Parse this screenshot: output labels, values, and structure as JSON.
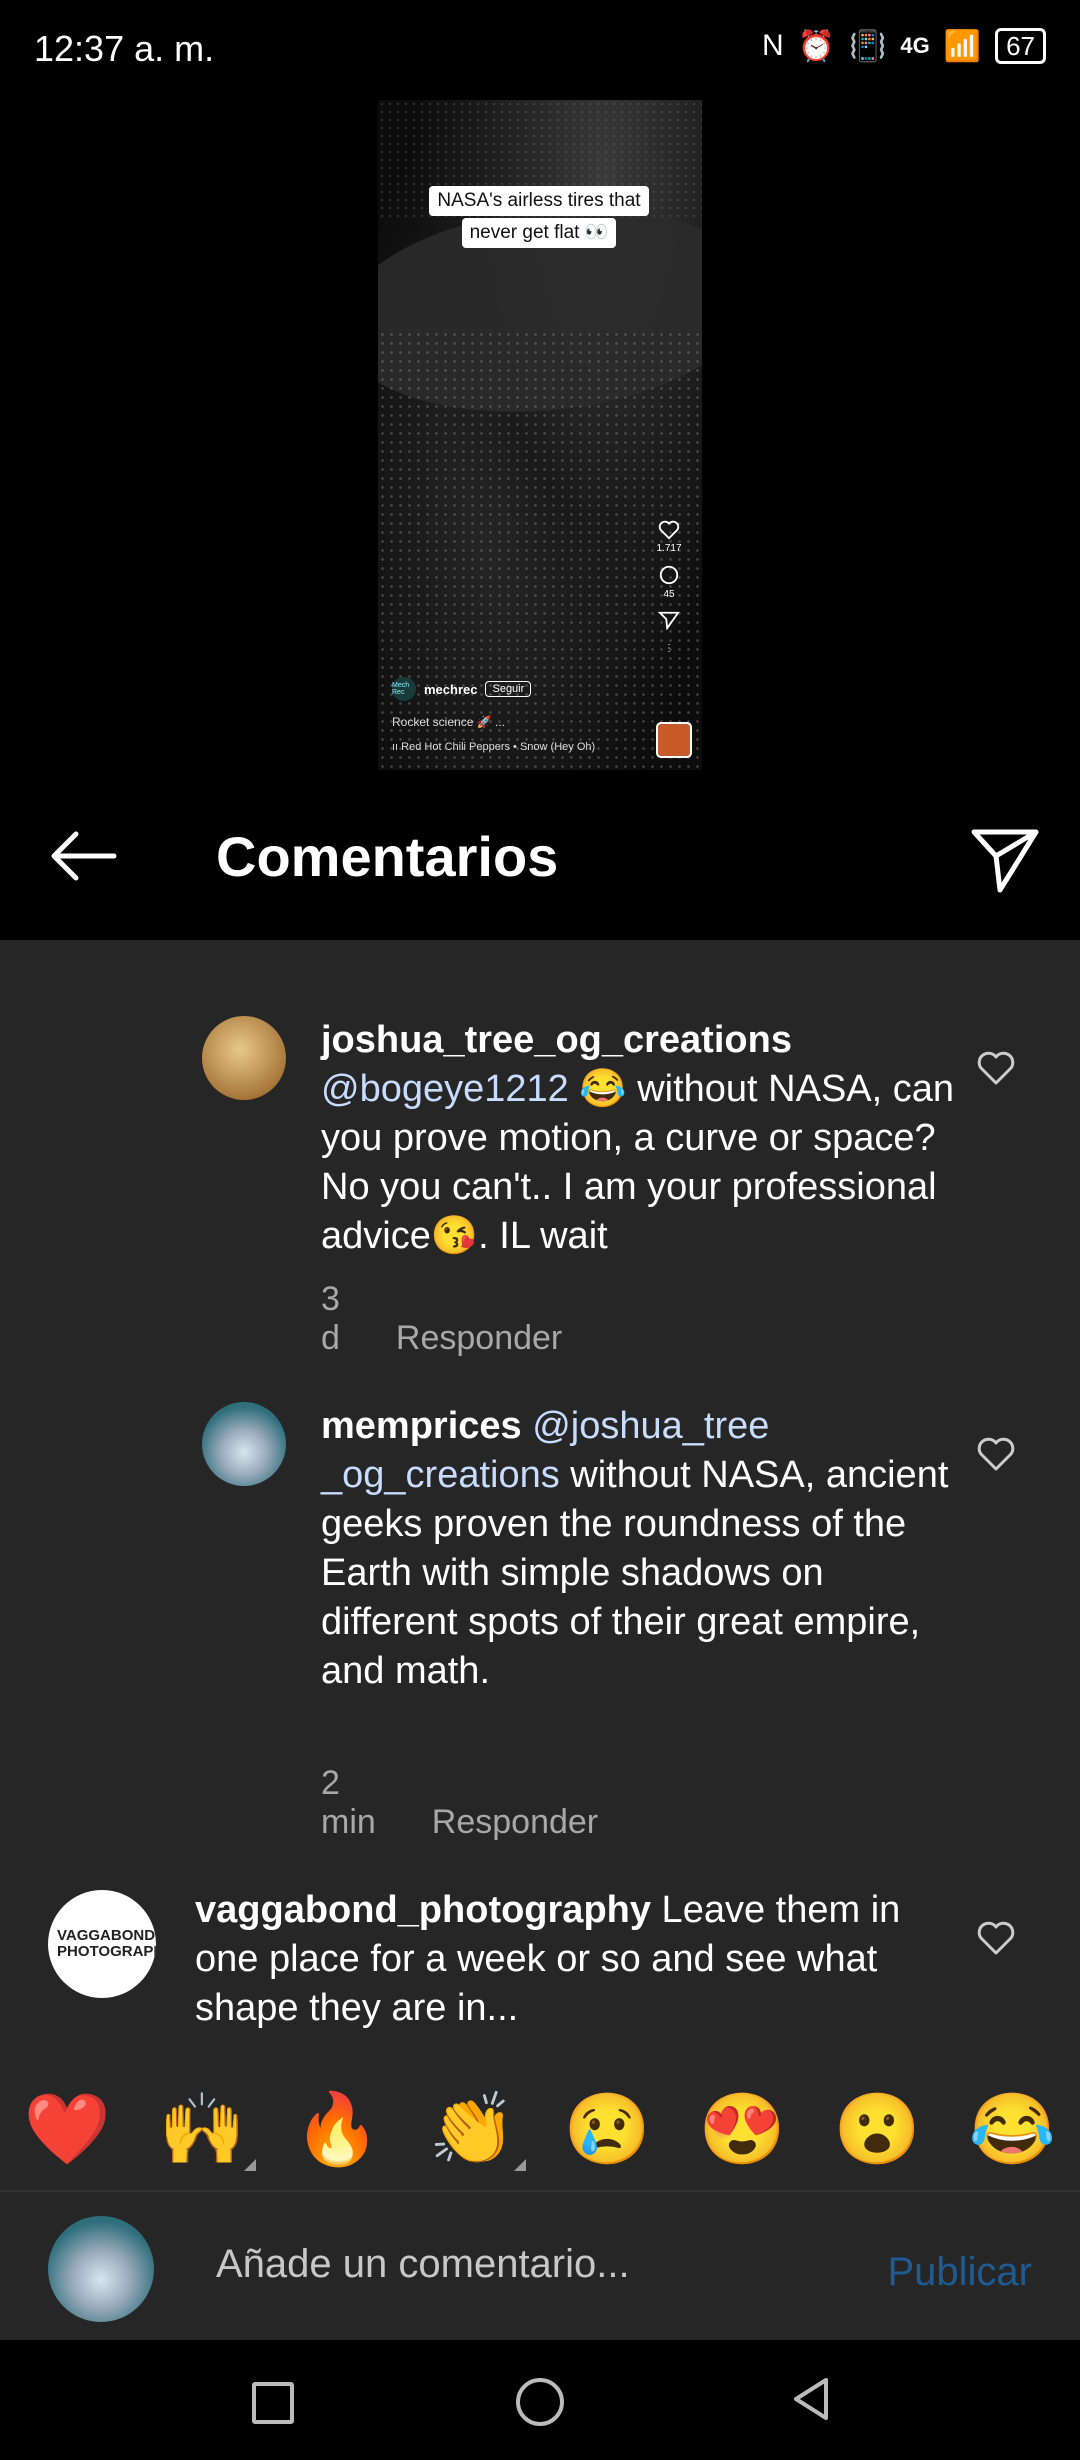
{
  "status_bar": {
    "time": "12:37 a. m.",
    "network": "4G",
    "battery": "67"
  },
  "reel": {
    "caption_line1": "NASA's airless tires that",
    "caption_line2": "never get flat 👀",
    "likes": "1.717",
    "comments": "45",
    "avatar_text": "Mech Rec",
    "username": "mechrec",
    "follow_label": "Seguir",
    "description": "Rocket science 🚀 ...",
    "music": "Red Hot Chili Peppers • Snow (Hey Oh)"
  },
  "header": {
    "title": "Comentarios"
  },
  "comments": [
    {
      "username": "joshua_tree_og_creations",
      "mention": "@bogeye1212",
      "text": " 😂 without NASA, can you prove motion, a curve or space?  No you can't.. I am your professional advice😘. IL wait",
      "time": "3 d",
      "reply_label": "Responder"
    },
    {
      "username": "memprices",
      "mention": " @joshua_tree _og_creations",
      "text": " without NASA, ancient geeks proven the roundness of the Earth with simple shadows on different spots of their great empire, and math.",
      "time": "2 min",
      "reply_label": "Responder"
    },
    {
      "username": "vaggabond_photography",
      "avatar_text": "VAGGABOND PHOTOGRAPHY",
      "text": " Leave them in one place for a week or so and see what shape they are in..."
    }
  ],
  "emoji_bar": [
    "❤️",
    "🙌",
    "🔥",
    "👏",
    "😢",
    "😍",
    "😮",
    "😂"
  ],
  "input": {
    "placeholder": "Añade un comentario...",
    "publish_label": "Publicar"
  }
}
